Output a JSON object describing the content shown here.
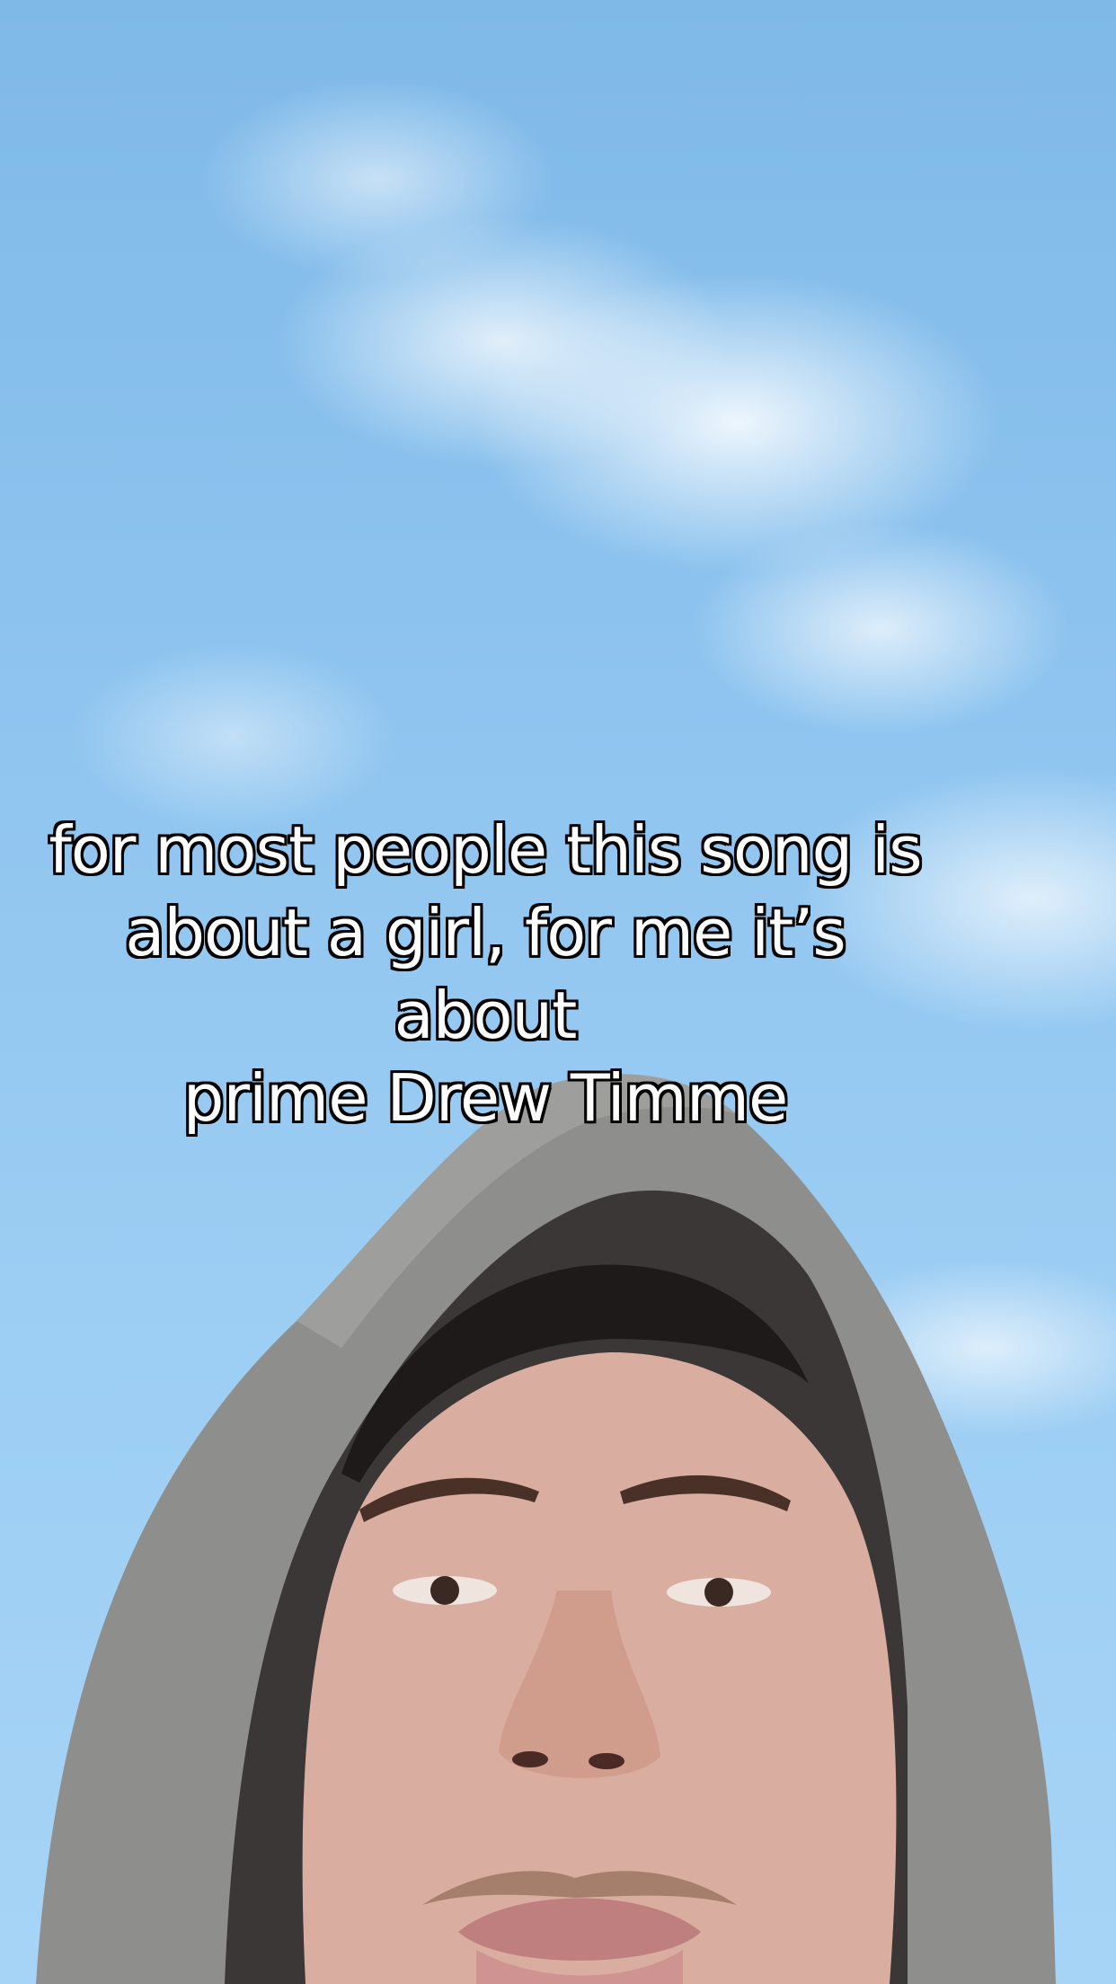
{
  "caption": {
    "text": "for most people this song is\nabout a girl, for me it’s about\nprime Drew Timme"
  },
  "scene": {
    "sky_color": "#8ec4ef",
    "hood_color": "#8e8f8d",
    "skin_color": "#d9aea0"
  }
}
